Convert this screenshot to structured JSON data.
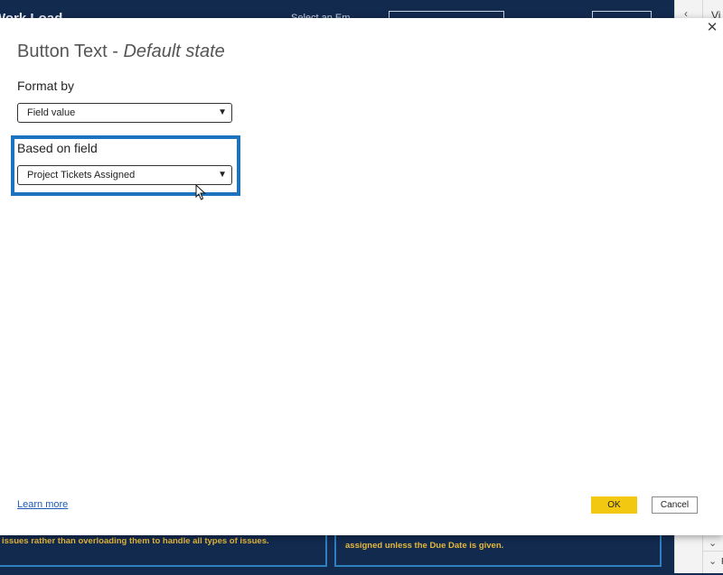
{
  "background": {
    "report_title": "Work Load",
    "top_text": "Select an Em",
    "card_left_text": "issues rather than overloading them to handle all types of issues.",
    "card_right_text": "assigned unless the Due Date is given."
  },
  "side_pane": {
    "header_label": "Vi",
    "row_letter": "F"
  },
  "dialog": {
    "title_main": "Button Text - ",
    "title_state": "Default state",
    "close_glyph": "✕",
    "format_by_label": "Format by",
    "format_by_value": "Field value",
    "based_on_field_label": "Based on field",
    "based_on_field_value": "Project Tickets Assigned",
    "learn_more": "Learn more",
    "ok_label": "OK",
    "cancel_label": "Cancel"
  },
  "colors": {
    "accent_yellow": "#f2c811",
    "highlight_blue": "#1e73be",
    "report_bg": "#132a4f"
  },
  "icons": {
    "dropdown": "chevron-down-icon",
    "close": "close-icon",
    "cursor": "mouse-pointer-icon"
  }
}
